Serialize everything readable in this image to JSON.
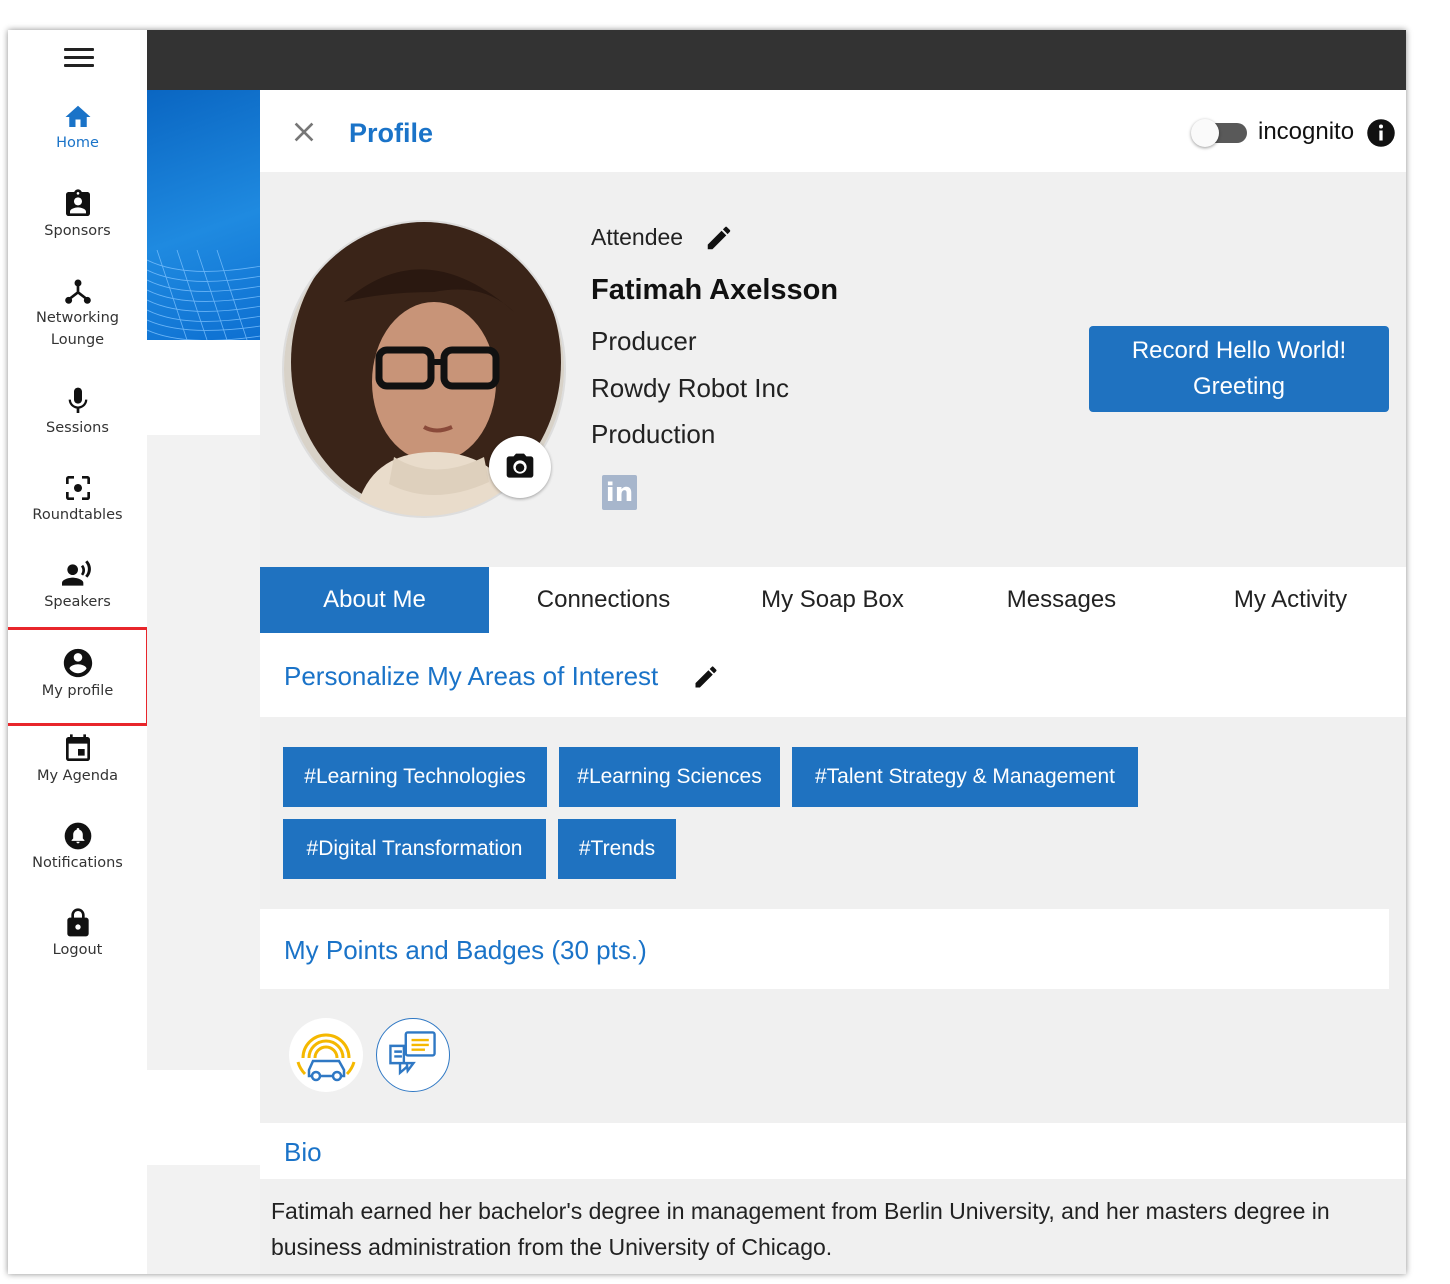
{
  "sidebar": {
    "items": [
      {
        "label": "Home",
        "icon": "home-icon",
        "active": true
      },
      {
        "label": "Sponsors",
        "icon": "badge-icon"
      },
      {
        "label": "Networking Lounge",
        "icon": "network-icon"
      },
      {
        "label": "Sessions",
        "icon": "microphone-icon"
      },
      {
        "label": "Roundtables",
        "icon": "center-focus-icon"
      },
      {
        "label": "Speakers",
        "icon": "speaker-person-icon"
      },
      {
        "label": "My profile",
        "icon": "account-circle-icon"
      },
      {
        "label": "My Agenda",
        "icon": "calendar-icon"
      },
      {
        "label": "Notifications",
        "icon": "bell-icon"
      },
      {
        "label": "Logout",
        "icon": "lock-icon"
      }
    ],
    "accent": "#1a73c8",
    "highlight_color": "#e8262b"
  },
  "panel": {
    "title": "Profile",
    "incognito_label": "incognito",
    "incognito_on": false
  },
  "profile": {
    "role": "Attendee",
    "name": "Fatimah Axelsson",
    "job_title": "Producer",
    "company": "Rowdy Robot Inc",
    "department": "Production",
    "linkedin_label": "in",
    "record_button": "Record Hello World! Greeting"
  },
  "tabs": [
    {
      "label": "About Me",
      "active": true
    },
    {
      "label": "Connections"
    },
    {
      "label": "My Soap Box"
    },
    {
      "label": "Messages"
    },
    {
      "label": "My Activity"
    }
  ],
  "interests": {
    "title": "Personalize My Areas of Interest",
    "chips": [
      "#Learning Technologies",
      "#Learning Sciences",
      "#Talent Strategy & Management",
      "#Digital Transformation",
      "#Trends"
    ]
  },
  "points": {
    "title": "My Points and Badges (30 pts.)",
    "badges": [
      "connected-car-badge-icon",
      "chat-bubbles-badge-icon"
    ]
  },
  "bio": {
    "title": "Bio",
    "text": "Fatimah earned her bachelor's degree in management from Berlin University, and her masters degree in business administration from the University of Chicago."
  },
  "colors": {
    "primary": "#1f72c0",
    "topbar": "#333333",
    "panel_bg": "#f0f0f0"
  }
}
